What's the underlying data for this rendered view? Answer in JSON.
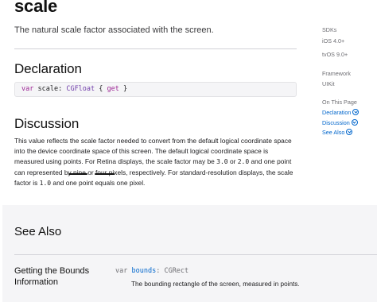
{
  "title": "scale",
  "abstract": "The natural scale factor associated with the screen.",
  "declaration": {
    "heading": "Declaration",
    "code": {
      "keyword": "var",
      "name": "scale",
      "colon": ":",
      "type": "CGFloat",
      "open_brace": "{",
      "getter": "get",
      "close_brace": "}"
    }
  },
  "discussion": {
    "heading": "Discussion",
    "text_1": "This value reflects the scale factor needed to convert from the default logical coordinate space into the device coordinate space of this screen. The default logical coordinate space is measured using points. For Retina displays, the scale factor may be ",
    "code_1": "3.0",
    "text_2": " or ",
    "code_2": "2.0",
    "text_3": " and one point can represented by ",
    "highlight_1": "nine",
    "text_4": " or ",
    "highlight_2": "four pixels",
    "text_5": ", respectively. For standard-resolution displays, the scale factor is ",
    "code_3": "1.0",
    "text_6": " and one point equals one pixel."
  },
  "sidebar": {
    "sdks_label": "SDKs",
    "sdk_ios": "iOS 4.0+",
    "sdk_tvos": "tvOS 9.0+",
    "framework_label": "Framework",
    "framework_value": "UIKit",
    "on_this_page_label": "On This Page",
    "links": [
      "Declaration",
      "Discussion",
      "See Also"
    ]
  },
  "see_also": {
    "heading": "See Also",
    "topic_title": "Getting the Bounds Information",
    "symbol": {
      "keyword": "var",
      "name": "bounds",
      "colon": ":",
      "type": "CGRect"
    },
    "symbol_description": "The bounding rectangle of the screen, measured in points."
  },
  "colors": {
    "link": "#0066cc",
    "keyword": "#9b2393",
    "type": "#703daa",
    "band_background": "#f5f5f7",
    "divider": "#d2d2d7"
  },
  "icons": {
    "sidebar_link_chevron": "chevron-circle-down-icon"
  }
}
